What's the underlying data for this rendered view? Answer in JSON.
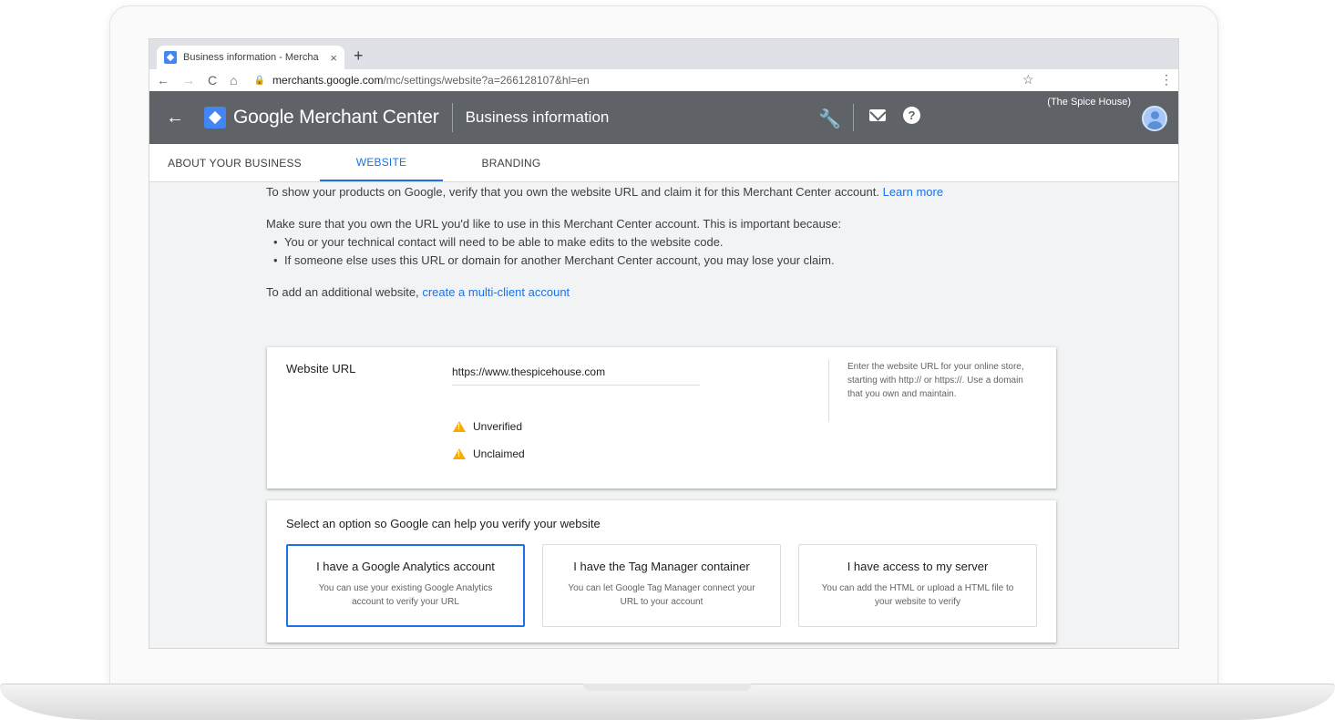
{
  "browser": {
    "tab_title": "Business information - Mercha",
    "tab_close": "×",
    "new_tab": "+",
    "url_host": "merchants.google.com",
    "url_path": "/mc/settings/website?a=266128107&hl=en"
  },
  "header": {
    "product_name": "Google Merchant Center",
    "page_title": "Business information",
    "account_name": "(The Spice House)",
    "icons": [
      "back-arrow-icon",
      "merchant-center-logo",
      "wrench-icon",
      "mail-icon",
      "help-icon",
      "avatar"
    ]
  },
  "tabs": [
    {
      "label": "ABOUT YOUR BUSINESS",
      "active": false
    },
    {
      "label": "WEBSITE",
      "active": true
    },
    {
      "label": "BRANDING",
      "active": false
    }
  ],
  "intro": {
    "line1": "To show your products on Google, verify that you own the website URL and claim it for this Merchant Center account.",
    "learn_more": "Learn more",
    "line2": "Make sure that you own the URL you'd like to use in this Merchant Center account. This is important because:",
    "bullets": [
      "You or your technical contact will need to be able to make edits to the website code.",
      "If someone else uses this URL or domain for another Merchant Center account, you may lose your claim."
    ],
    "line3": "To add an additional website,",
    "multi_client_link": "create a multi-client account"
  },
  "website_card": {
    "label": "Website URL",
    "url_value": "https://www.thespicehouse.com",
    "status_unverified": "Unverified",
    "status_unclaimed": "Unclaimed",
    "help_text": "Enter the website URL for your online store, starting with http:// or https://. Use a domain that you own and maintain."
  },
  "verify_card": {
    "title": "Select an option so Google can help you verify your website",
    "options": [
      {
        "title": "I have a Google Analytics account",
        "desc": "You can use your existing Google Analytics account to verify your URL",
        "selected": true
      },
      {
        "title": "I have the Tag Manager container",
        "desc": "You can let Google Tag Manager connect your URL to your account",
        "selected": false
      },
      {
        "title": "I have access to my server",
        "desc": "You can add the HTML or upload a HTML file to your website to verify",
        "selected": false
      }
    ]
  },
  "colors": {
    "accent": "#1a73e8",
    "header_bg": "#5f6368",
    "warning": "#f9ab00"
  }
}
